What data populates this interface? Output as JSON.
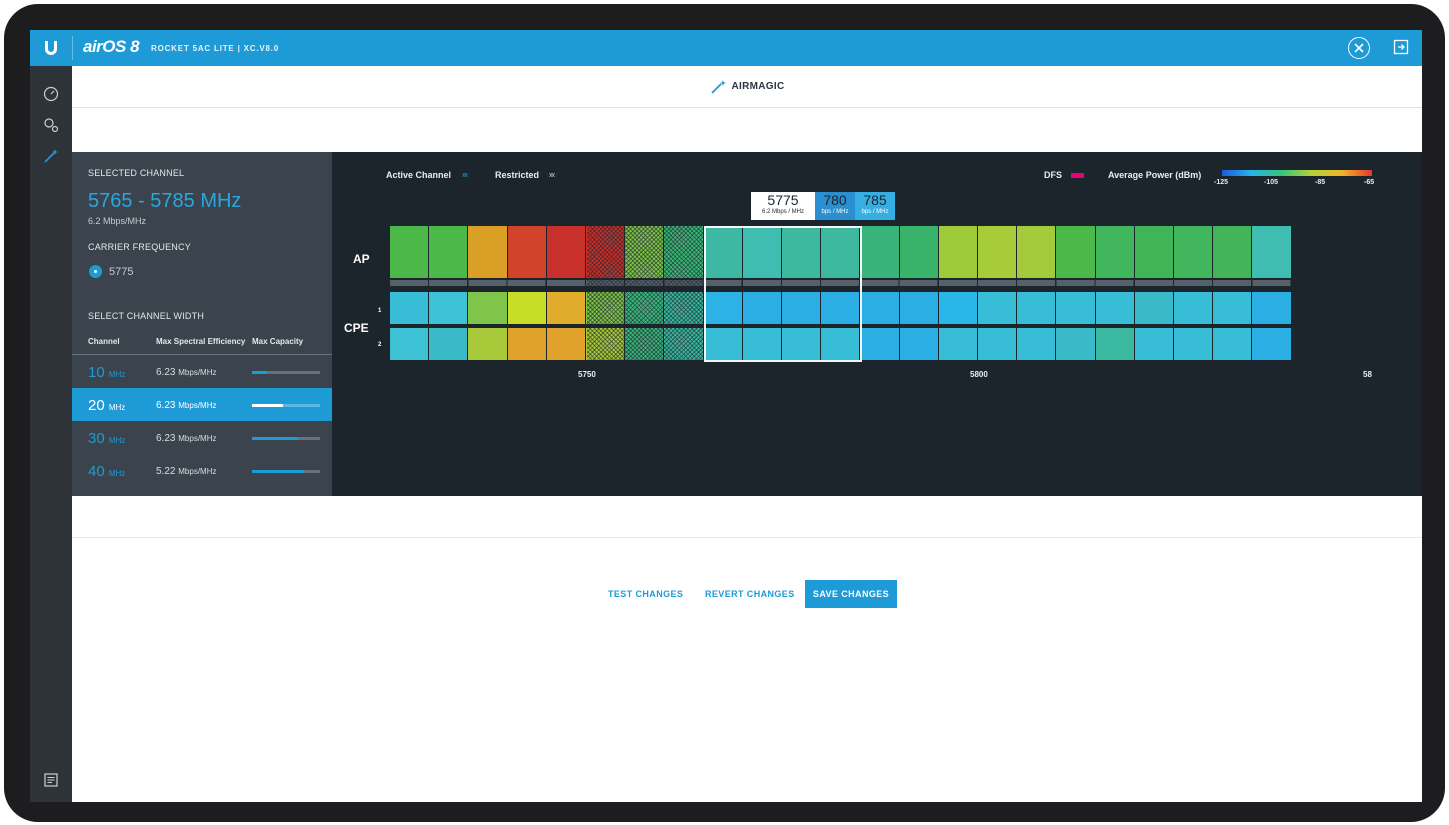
{
  "header": {
    "brand": "airOS 8",
    "device": "ROCKET 5AC LITE | XC.V8.0"
  },
  "page": {
    "title": "AIRMAGIC"
  },
  "panel": {
    "selected_channel_label": "SELECTED CHANNEL",
    "selected_channel_value": "5765 - 5785 MHz",
    "selected_channel_efficiency": "6.2 Mbps/MHz",
    "carrier_label": "CARRIER FREQUENCY",
    "carrier_value": "5775",
    "width_label": "SELECT CHANNEL WIDTH",
    "columns": [
      "Channel",
      "Max Spectral Efficiency",
      "Max Capacity"
    ],
    "rows": [
      {
        "width": "10",
        "unit": "MHz",
        "eff": "6.23",
        "eff_unit": "Mbps/MHz",
        "capacity": 0.22,
        "selected": false
      },
      {
        "width": "20",
        "unit": "MHz",
        "eff": "6.23",
        "eff_unit": "Mbps/MHz",
        "capacity": 0.46,
        "selected": true
      },
      {
        "width": "30",
        "unit": "MHz",
        "eff": "6.23",
        "eff_unit": "Mbps/MHz",
        "capacity": 0.68,
        "selected": false
      },
      {
        "width": "40",
        "unit": "MHz",
        "eff": "5.22",
        "eff_unit": "Mbps/MHz",
        "capacity": 0.76,
        "selected": false
      }
    ]
  },
  "legend": {
    "active_channel": "Active Channel",
    "restricted": "Restricted",
    "x_marker": "xx",
    "dfs": "DFS",
    "average_power": "Average Power (dBm)",
    "scale": [
      "-125",
      "-105",
      "-85",
      "-65"
    ]
  },
  "spectrum": {
    "ap_label": "AP",
    "cpe_label": "CPE",
    "cpe_sub_1": "1",
    "cpe_sub_2": "2",
    "x_ticks": [
      "5750",
      "5800",
      "58"
    ],
    "tooltips": [
      {
        "freq": "5775",
        "eff": "6.2 Mbps / MHz"
      },
      {
        "freq": "780",
        "eff": "bps / MHz"
      },
      {
        "freq": "785",
        "eff": "bps / MHz"
      }
    ],
    "colors": {
      "ap": [
        "#4bb849",
        "#4bb849",
        "#d9a025",
        "#d2432b",
        "#c8302b",
        "#c8302b",
        "#7ec54a",
        "#39b977",
        "#3cb8a3",
        "#3fbdb0",
        "#3db9a0",
        "#3db9a0",
        "#38b47a",
        "#39b26a",
        "#9ecb3a",
        "#a7cc3a",
        "#a3ca3a",
        "#4bb849",
        "#41b65c",
        "#3fb557",
        "#41b65c",
        "#44b45a",
        "#3fbdb0"
      ],
      "cpe1": [
        "#37bed6",
        "#3cc2d4",
        "#7ec54a",
        "#c8dd28",
        "#e0ac2b",
        "#7ec54a",
        "#3ab67c",
        "#3ab9a0",
        "#2cb2e4",
        "#2aaee4",
        "#2aaee4",
        "#2aaee4",
        "#2aaee4",
        "#2aaee4",
        "#2ab6e9",
        "#37bed6",
        "#37bed6",
        "#37bed6",
        "#37bed6",
        "#3ab9c8",
        "#37bed6",
        "#37bed6",
        "#2aaee4"
      ],
      "cpe2": [
        "#3cc2d4",
        "#3ab9c8",
        "#a8c93a",
        "#e0a22b",
        "#e0a22b",
        "#a8c93a",
        "#3ab67c",
        "#3ab9a0",
        "#37bed6",
        "#37bed6",
        "#37bed6",
        "#37bed6",
        "#2aaee4",
        "#2aaee4",
        "#37bed6",
        "#37bed6",
        "#37bed6",
        "#3ab9c8",
        "#3ab9a0",
        "#37bed6",
        "#37bed6",
        "#37bed6",
        "#2aaee4"
      ]
    }
  },
  "actions": {
    "test": "TEST CHANGES",
    "revert": "REVERT CHANGES",
    "save": "SAVE CHANGES"
  }
}
